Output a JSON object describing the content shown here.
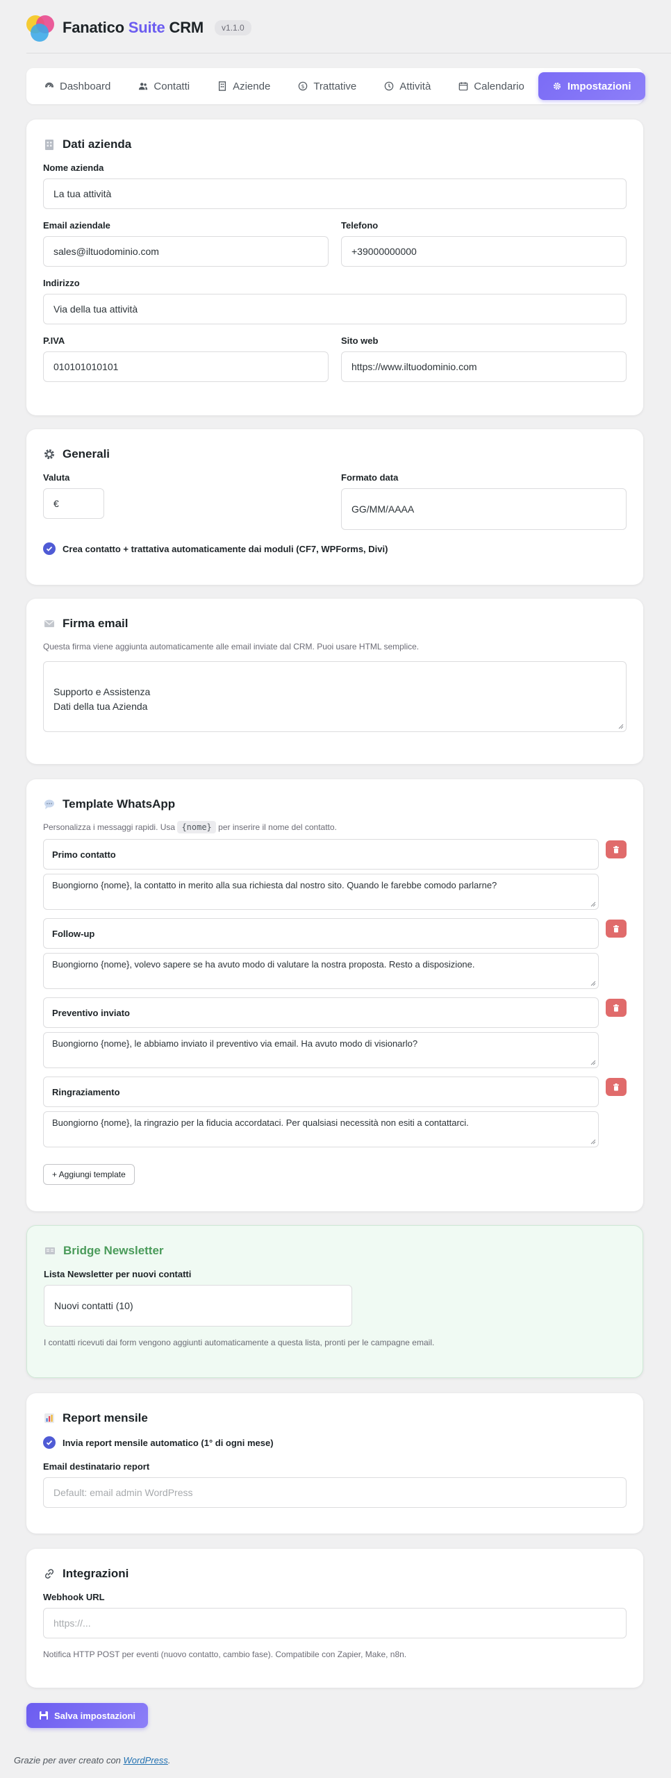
{
  "app": {
    "name_part1": "Fanatico",
    "name_part2": "Suite",
    "name_part3": "CRM",
    "version": "v1.1.0"
  },
  "colors": {
    "accent": "#6b5cf0",
    "check": "#4f5bd5",
    "danger": "#e06b6b",
    "green_title": "#4a9b5a"
  },
  "nav": {
    "tabs": [
      {
        "label": "Dashboard",
        "icon": "dashboard-icon"
      },
      {
        "label": "Contatti",
        "icon": "users-icon"
      },
      {
        "label": "Aziende",
        "icon": "building-icon"
      },
      {
        "label": "Trattative",
        "icon": "dollar-icon"
      },
      {
        "label": "Attività",
        "icon": "clock-icon"
      },
      {
        "label": "Calendario",
        "icon": "calendar-icon"
      },
      {
        "label": "Impostazioni",
        "icon": "gear-icon",
        "active": true
      }
    ]
  },
  "company": {
    "title": "Dati azienda",
    "name_label": "Nome azienda",
    "name_value": "La tua attività",
    "email_label": "Email aziendale",
    "email_value": "sales@iltuodominio.com",
    "phone_label": "Telefono",
    "phone_value": "+39000000000",
    "address_label": "Indirizzo",
    "address_value": "Via della tua attività",
    "vat_label": "P.IVA",
    "vat_value": "010101010101",
    "web_label": "Sito web",
    "web_value": "https://www.iltuodominio.com"
  },
  "general": {
    "title": "Generali",
    "currency_label": "Valuta",
    "currency_value": "€",
    "date_label": "Formato data",
    "date_value": "GG/MM/AAAA",
    "auto_label": "Crea contatto + trattativa automaticamente dai moduli (CF7, WPForms, Divi)"
  },
  "signature": {
    "title": "Firma email",
    "help": "Questa firma viene aggiunta automaticamente alle email inviate dal CRM. Puoi usare HTML semplice.",
    "value": "Supporto e Assistenza\nDati della tua Azienda"
  },
  "whatsapp": {
    "title": "Template WhatsApp",
    "help_pre": "Personalizza i messaggi rapidi. Usa",
    "help_code": "{nome}",
    "help_post": "per inserire il nome del contatto.",
    "templates": [
      {
        "name": "Primo contatto",
        "text": "Buongiorno {nome}, la contatto in merito alla sua richiesta dal nostro sito. Quando le farebbe comodo parlarne?"
      },
      {
        "name": "Follow-up",
        "text": "Buongiorno {nome}, volevo sapere se ha avuto modo di valutare la nostra proposta. Resto a disposizione."
      },
      {
        "name": "Preventivo inviato",
        "text": "Buongiorno {nome}, le abbiamo inviato il preventivo via email. Ha avuto modo di visionarlo?"
      },
      {
        "name": "Ringraziamento",
        "text": "Buongiorno {nome}, la ringrazio per la fiducia accordataci. Per qualsiasi necessità non esiti a contattarci."
      }
    ],
    "add_label": "+ Aggiungi template"
  },
  "newsletter": {
    "title": "Bridge Newsletter",
    "list_label": "Lista Newsletter per nuovi contatti",
    "list_value": "Nuovi contatti (10)",
    "help": "I contatti ricevuti dai form vengono aggiunti automaticamente a questa lista, pronti per le campagne email."
  },
  "report": {
    "title": "Report mensile",
    "check_label": "Invia report mensile automatico (1° di ogni mese)",
    "email_label": "Email destinatario report",
    "email_placeholder": "Default: email admin WordPress"
  },
  "integrations": {
    "title": "Integrazioni",
    "webhook_label": "Webhook URL",
    "webhook_placeholder": "https://...",
    "help": "Notifica HTTP POST per eventi (nuovo contatto, cambio fase). Compatibile con Zapier, Make, n8n."
  },
  "save_label": "Salva impostazioni",
  "footer": {
    "text": "Grazie per aver creato con",
    "link": "WordPress",
    "end": "."
  }
}
